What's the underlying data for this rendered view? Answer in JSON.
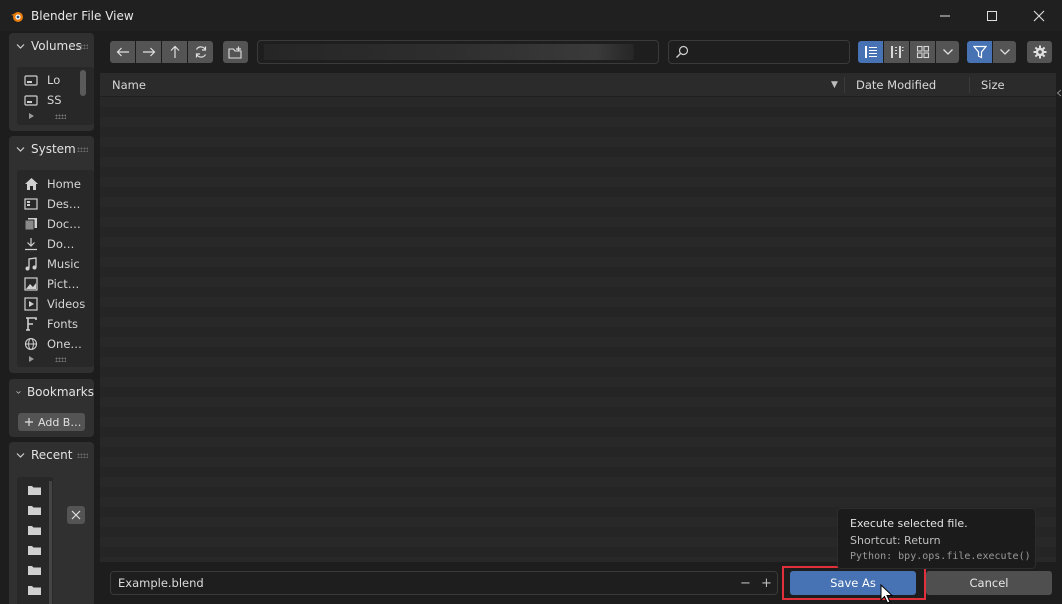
{
  "window": {
    "title": "Blender File View",
    "minimize_icon": "minimize-icon",
    "maximize_icon": "maximize-icon",
    "close_icon": "close-icon"
  },
  "sidebar": {
    "volumes": {
      "title": "Volumes",
      "items": [
        {
          "label": "Lo",
          "icon": "drive-icon"
        },
        {
          "label": "SS",
          "icon": "drive-icon"
        }
      ]
    },
    "system": {
      "title": "System",
      "items": [
        {
          "label": "Home",
          "icon": "home-icon"
        },
        {
          "label": "Des…",
          "icon": "desktop-icon"
        },
        {
          "label": "Doc…",
          "icon": "documents-icon"
        },
        {
          "label": "Do…",
          "icon": "download-icon"
        },
        {
          "label": "Music",
          "icon": "music-icon"
        },
        {
          "label": "Pict…",
          "icon": "pictures-icon"
        },
        {
          "label": "Videos",
          "icon": "videos-icon"
        },
        {
          "label": "Fonts",
          "icon": "fonts-icon"
        },
        {
          "label": "One…",
          "icon": "globe-icon"
        }
      ]
    },
    "bookmarks": {
      "title": "Bookmarks",
      "add_label": "Add B…"
    },
    "recent": {
      "title": "Recent",
      "count": 6
    }
  },
  "filelist": {
    "columns": [
      "Name",
      "Date Modified",
      "Size"
    ],
    "sort_indicator": "▼"
  },
  "bottom": {
    "filename": "Example.blend",
    "minus": "−",
    "plus": "+",
    "save_label": "Save As",
    "cancel_label": "Cancel"
  },
  "tooltip": {
    "line1": "Execute selected file.",
    "line2": "Shortcut: Return",
    "line3": "Python: bpy.ops.file.execute()"
  },
  "colors": {
    "accent": "#4772b3",
    "highlight": "#e0303b",
    "background": "#1d1d1d",
    "panel": "#303030"
  }
}
